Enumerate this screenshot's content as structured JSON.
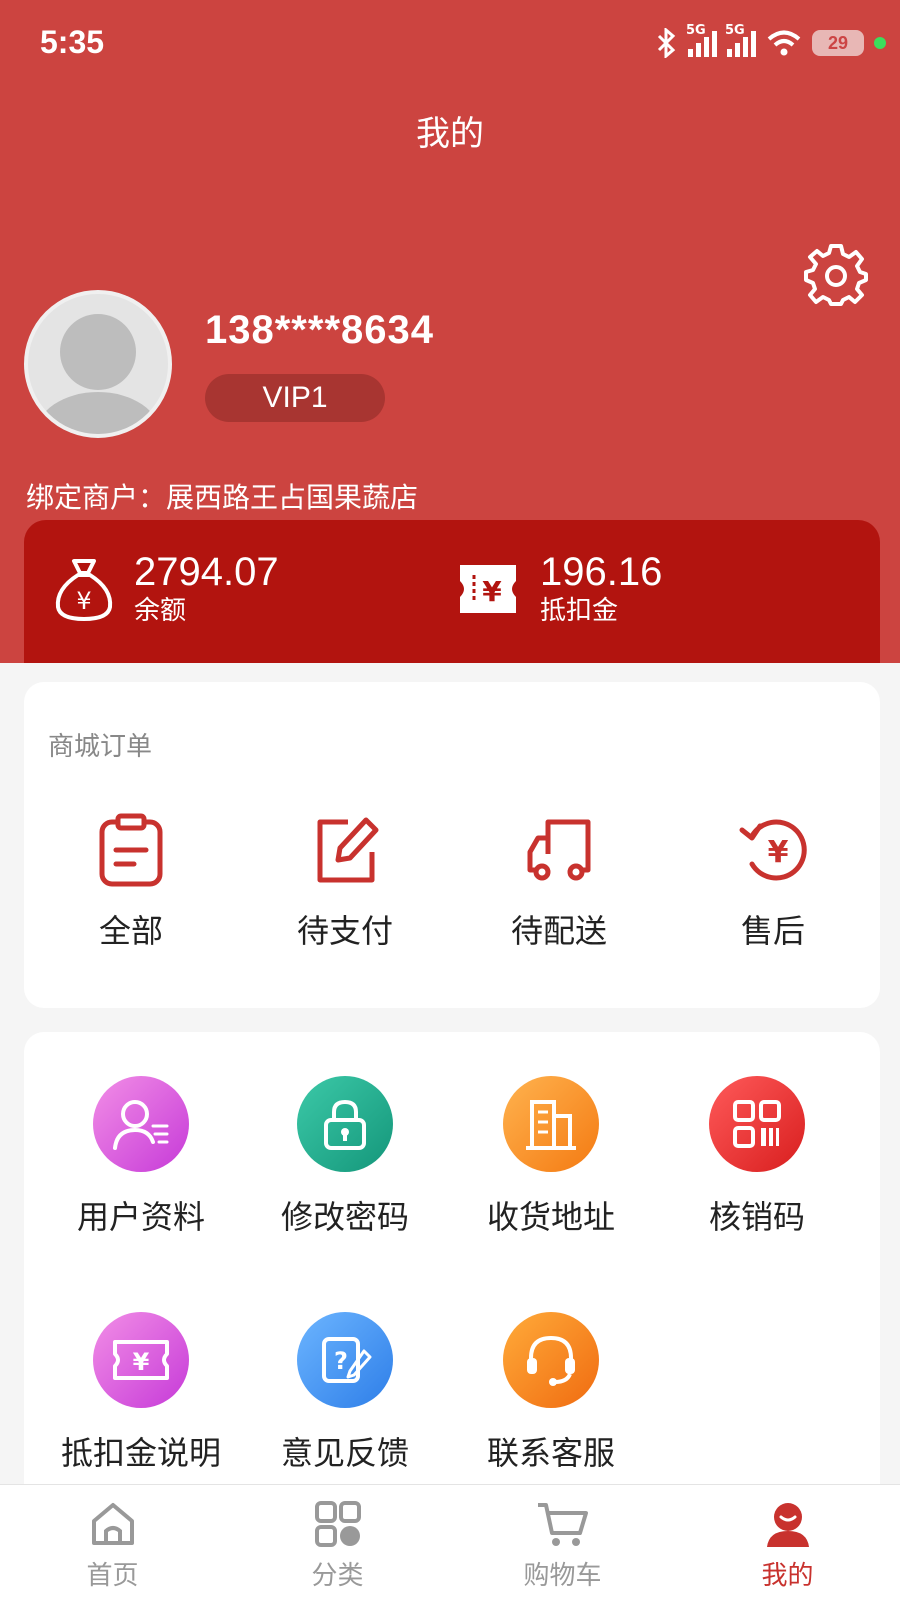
{
  "status_bar": {
    "time": "5:35",
    "signal_1": "5G",
    "signal_2": "5G",
    "battery": "29"
  },
  "header": {
    "title": "我的"
  },
  "profile": {
    "phone": "138****8634",
    "vip_level": "VIP1",
    "merchant": "绑定商户：展西路王占国果蔬店"
  },
  "wallet": {
    "balance": {
      "value": "2794.07",
      "label": "余额"
    },
    "deduction": {
      "value": "196.16",
      "label": "抵扣金"
    }
  },
  "orders": {
    "title": "商城订单",
    "items": [
      {
        "label": "全部",
        "icon": "clipboard-icon"
      },
      {
        "label": "待支付",
        "icon": "edit-icon"
      },
      {
        "label": "待配送",
        "icon": "truck-icon"
      },
      {
        "label": "售后",
        "icon": "refund-icon"
      }
    ]
  },
  "services": {
    "items": [
      {
        "label": "用户资料",
        "icon": "user-profile-icon"
      },
      {
        "label": "修改密码",
        "icon": "lock-icon"
      },
      {
        "label": "收货地址",
        "icon": "building-icon"
      },
      {
        "label": "核销码",
        "icon": "qrcode-icon"
      },
      {
        "label": "抵扣金说明",
        "icon": "coupon-icon"
      },
      {
        "label": "意见反馈",
        "icon": "feedback-icon"
      },
      {
        "label": "联系客服",
        "icon": "headset-icon"
      }
    ]
  },
  "tabbar": {
    "items": [
      {
        "label": "首页",
        "icon": "home-icon"
      },
      {
        "label": "分类",
        "icon": "category-icon"
      },
      {
        "label": "购物车",
        "icon": "cart-icon"
      },
      {
        "label": "我的",
        "icon": "profile-icon"
      }
    ],
    "active_index": 3
  },
  "colors": {
    "brand_red": "#cc4440",
    "wallet_red": "#b2140f",
    "icon_red": "#c8322e",
    "active_tab": "#c8322e"
  }
}
